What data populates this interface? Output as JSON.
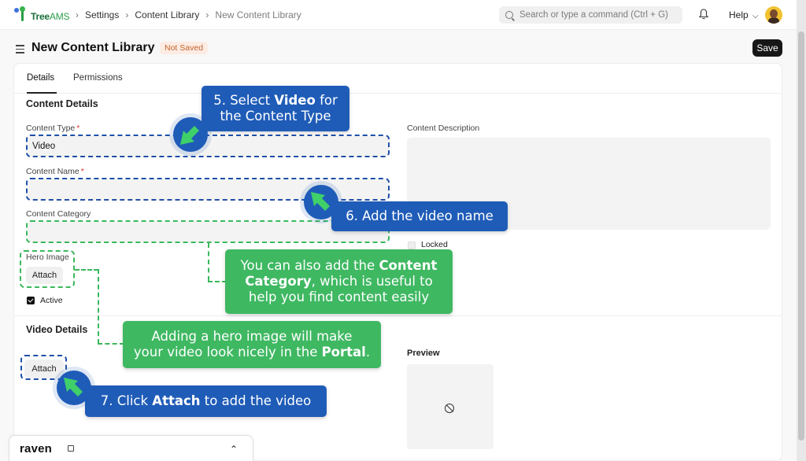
{
  "header": {
    "logo_main": "Tree",
    "logo_suffix": "AMS",
    "breadcrumbs": [
      "Settings",
      "Content Library",
      "New Content Library"
    ],
    "search_placeholder": "Search or type a command (Ctrl + G)",
    "help_label": "Help",
    "help_caret": "⌵",
    "bell_icon": "🔔"
  },
  "page": {
    "title": "New Content Library",
    "status": "Not Saved",
    "save_label": "Save"
  },
  "tabs": [
    "Details",
    "Permissions"
  ],
  "content_details": {
    "section_title": "Content Details",
    "content_type_label": "Content Type",
    "content_type_value": "Video",
    "content_name_label": "Content Name",
    "content_category_label": "Content Category",
    "hero_image_label": "Hero Image",
    "attach_label": "Attach",
    "active_label": "Active",
    "content_description_label": "Content Description",
    "locked_label": "Locked",
    "required_mark": "*"
  },
  "video_details": {
    "section_title": "Video Details",
    "attach_label": "Attach",
    "preview_label": "Preview"
  },
  "callouts": {
    "step5": {
      "pre": "5. Select ",
      "bold": "Video",
      "post": " for",
      "line2": "the Content Type"
    },
    "step6": {
      "text": "6. Add the video name"
    },
    "category": {
      "pre": "You can also add the ",
      "bold1": "Content",
      "bold2": "Category",
      "post": ", which is useful to",
      "line3": "help you find content easily"
    },
    "hero": {
      "line1": "Adding a hero image will make",
      "pre": "your video look nicely in the ",
      "bold": "Portal",
      "post": "."
    },
    "step7": {
      "pre": "7. Click ",
      "bold": "Attach",
      "post": " to add the video"
    }
  },
  "footer_widget": {
    "name": "raven",
    "chevron": "⌃"
  },
  "colors": {
    "callout_blue": "#1f5cb8",
    "callout_green": "#3fb862",
    "highlight_blue": "#1f4fa8",
    "highlight_green": "#3bb85b",
    "not_saved_badge": "#c2632d"
  }
}
